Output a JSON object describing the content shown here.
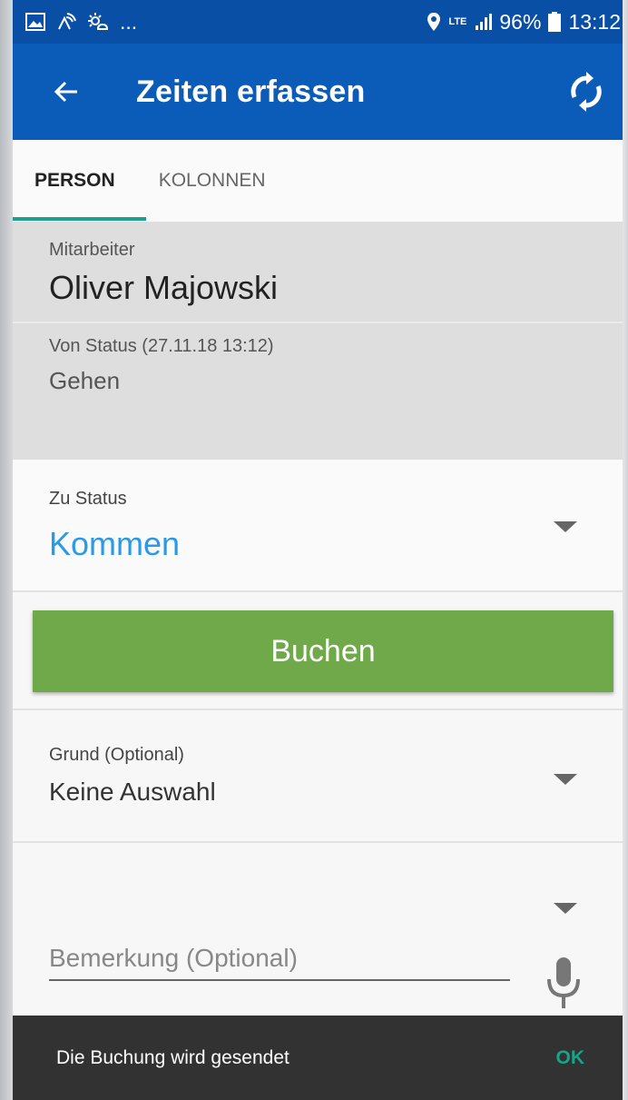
{
  "status_bar": {
    "dots": "...",
    "lte": "LTE",
    "battery": "96%",
    "time": "13:12"
  },
  "appbar": {
    "title": "Zeiten erfassen"
  },
  "tabs": [
    {
      "label": "PERSON",
      "active": true
    },
    {
      "label": "KOLONNEN",
      "active": false
    }
  ],
  "info": {
    "employee_label": "Mitarbeiter",
    "employee_name": "Oliver Majowski",
    "from_status_label": "Von Status (27.11.18 13:12)",
    "from_status_value": "Gehen"
  },
  "to_status": {
    "label": "Zu Status",
    "value": "Kommen"
  },
  "book_button": "Buchen",
  "reason": {
    "label": "Grund (Optional)",
    "value": "Keine Auswahl"
  },
  "remark": {
    "placeholder": "Bemerkung (Optional)"
  },
  "snackbar": {
    "message": "Die Buchung wird gesendet",
    "action": "OK"
  },
  "colors": {
    "statusbar": "#0a4fa6",
    "appbar": "#0b5cb8",
    "accent": "#1aa38a",
    "button": "#6fa94a",
    "link": "#2a9ae6"
  }
}
